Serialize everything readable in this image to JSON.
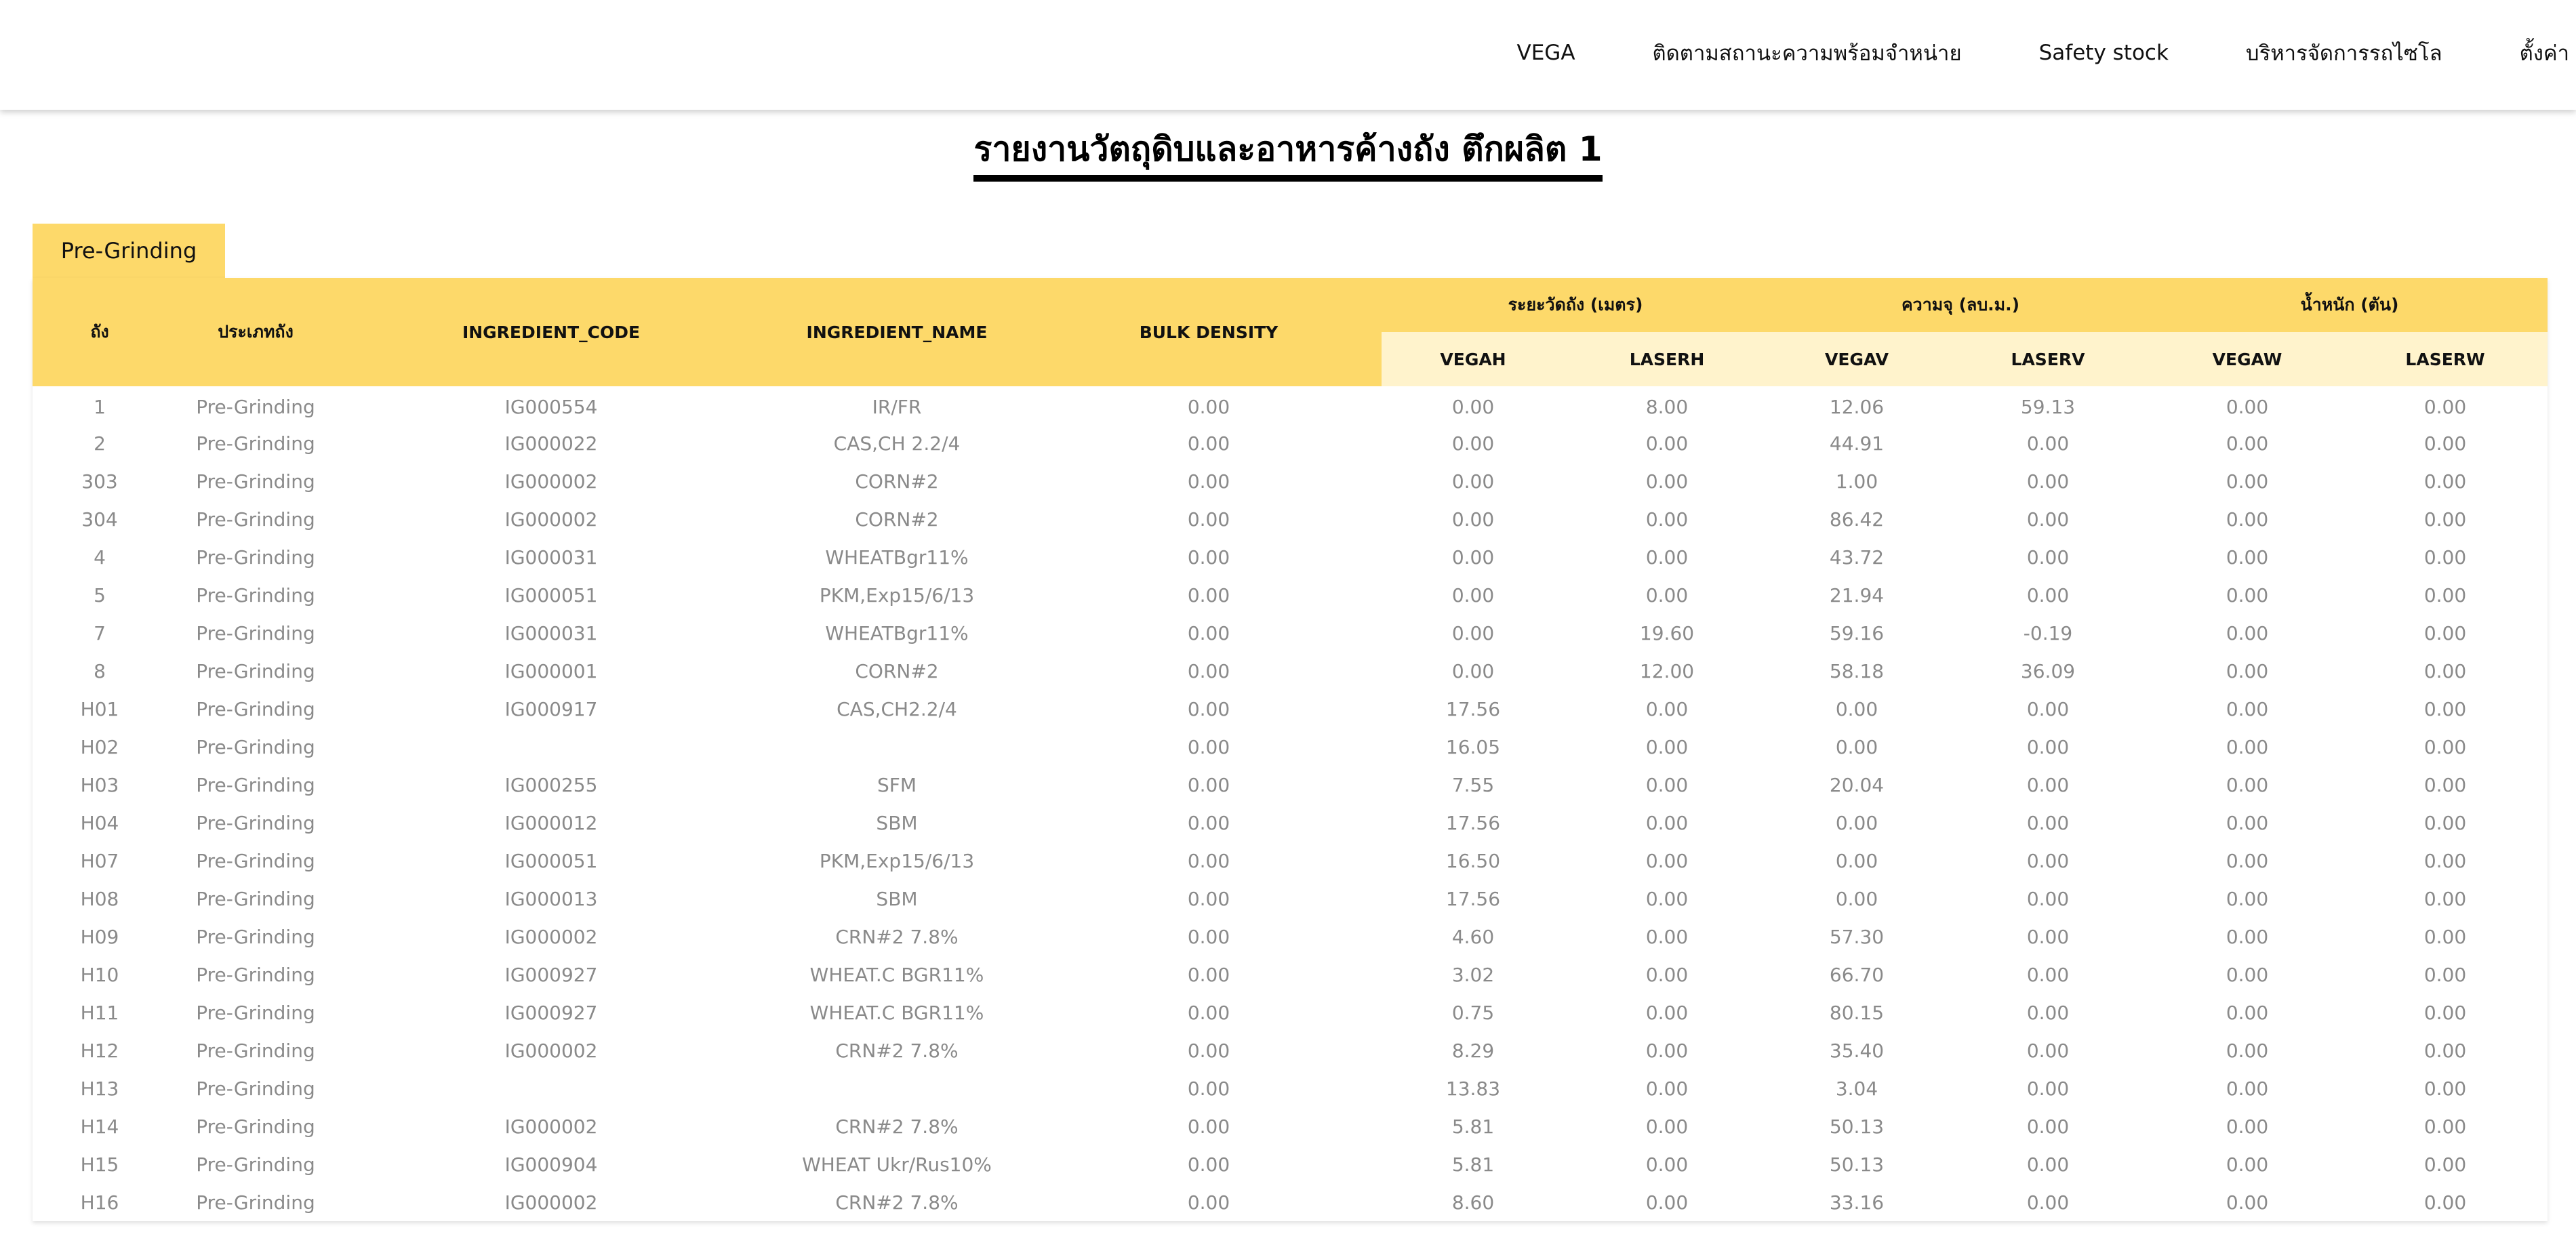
{
  "nav": {
    "items": [
      "VEGA",
      "ติดตามสถานะความพร้อมจำหน่าย",
      "Safety stock",
      "บริหารจัดการรถไซโล",
      "ตั้งค่า"
    ]
  },
  "page": {
    "title": "รายงานวัตถุดิบและอาหารค้างถัง ตึกผลิต 1"
  },
  "tab": {
    "label": "Pre-Grinding"
  },
  "colors": {
    "header_yellow": "#fdd96a",
    "subheader_yellow": "#fff3cc",
    "cell_text": "#8a8a8a"
  },
  "table": {
    "headers": {
      "tank": "ถัง",
      "tank_type": "ประเภทถัง",
      "ingredient_code": "INGREDIENT_CODE",
      "ingredient_name": "INGREDIENT_NAME",
      "bulk_density": "BULK DENSITY",
      "group_distance": "ระยะวัดถัง (เมตร)",
      "group_volume": "ความจุ (ลบ.ม.)",
      "group_weight": "น้ำหนัก (ตัน)",
      "vegah": "VEGAH",
      "laserh": "LASERH",
      "vegav": "VEGAV",
      "laserv": "LASERV",
      "vegaw": "VEGAW",
      "laserw": "LASERW"
    },
    "rows": [
      [
        "1",
        "Pre-Grinding",
        "IG000554",
        "IR/FR",
        "0.00",
        "0.00",
        "8.00",
        "12.06",
        "59.13",
        "0.00",
        "0.00"
      ],
      [
        "2",
        "Pre-Grinding",
        "IG000022",
        "CAS,CH 2.2/4",
        "0.00",
        "0.00",
        "0.00",
        "44.91",
        "0.00",
        "0.00",
        "0.00"
      ],
      [
        "303",
        "Pre-Grinding",
        "IG000002",
        "CORN#2",
        "0.00",
        "0.00",
        "0.00",
        "1.00",
        "0.00",
        "0.00",
        "0.00"
      ],
      [
        "304",
        "Pre-Grinding",
        "IG000002",
        "CORN#2",
        "0.00",
        "0.00",
        "0.00",
        "86.42",
        "0.00",
        "0.00",
        "0.00"
      ],
      [
        "4",
        "Pre-Grinding",
        "IG000031",
        "WHEATBgr11%",
        "0.00",
        "0.00",
        "0.00",
        "43.72",
        "0.00",
        "0.00",
        "0.00"
      ],
      [
        "5",
        "Pre-Grinding",
        "IG000051",
        "PKM,Exp15/6/13",
        "0.00",
        "0.00",
        "0.00",
        "21.94",
        "0.00",
        "0.00",
        "0.00"
      ],
      [
        "7",
        "Pre-Grinding",
        "IG000031",
        "WHEATBgr11%",
        "0.00",
        "0.00",
        "19.60",
        "59.16",
        "-0.19",
        "0.00",
        "0.00"
      ],
      [
        "8",
        "Pre-Grinding",
        "IG000001",
        "CORN#2",
        "0.00",
        "0.00",
        "12.00",
        "58.18",
        "36.09",
        "0.00",
        "0.00"
      ],
      [
        "H01",
        "Pre-Grinding",
        "IG000917",
        "CAS,CH2.2/4",
        "0.00",
        "17.56",
        "0.00",
        "0.00",
        "0.00",
        "0.00",
        "0.00"
      ],
      [
        "H02",
        "Pre-Grinding",
        "",
        "",
        "0.00",
        "16.05",
        "0.00",
        "0.00",
        "0.00",
        "0.00",
        "0.00"
      ],
      [
        "H03",
        "Pre-Grinding",
        "IG000255",
        "SFM",
        "0.00",
        "7.55",
        "0.00",
        "20.04",
        "0.00",
        "0.00",
        "0.00"
      ],
      [
        "H04",
        "Pre-Grinding",
        "IG000012",
        "SBM",
        "0.00",
        "17.56",
        "0.00",
        "0.00",
        "0.00",
        "0.00",
        "0.00"
      ],
      [
        "H07",
        "Pre-Grinding",
        "IG000051",
        "PKM,Exp15/6/13",
        "0.00",
        "16.50",
        "0.00",
        "0.00",
        "0.00",
        "0.00",
        "0.00"
      ],
      [
        "H08",
        "Pre-Grinding",
        "IG000013",
        "SBM",
        "0.00",
        "17.56",
        "0.00",
        "0.00",
        "0.00",
        "0.00",
        "0.00"
      ],
      [
        "H09",
        "Pre-Grinding",
        "IG000002",
        "CRN#2 7.8%",
        "0.00",
        "4.60",
        "0.00",
        "57.30",
        "0.00",
        "0.00",
        "0.00"
      ],
      [
        "H10",
        "Pre-Grinding",
        "IG000927",
        "WHEAT.C BGR11%",
        "0.00",
        "3.02",
        "0.00",
        "66.70",
        "0.00",
        "0.00",
        "0.00"
      ],
      [
        "H11",
        "Pre-Grinding",
        "IG000927",
        "WHEAT.C BGR11%",
        "0.00",
        "0.75",
        "0.00",
        "80.15",
        "0.00",
        "0.00",
        "0.00"
      ],
      [
        "H12",
        "Pre-Grinding",
        "IG000002",
        "CRN#2 7.8%",
        "0.00",
        "8.29",
        "0.00",
        "35.40",
        "0.00",
        "0.00",
        "0.00"
      ],
      [
        "H13",
        "Pre-Grinding",
        "",
        "",
        "0.00",
        "13.83",
        "0.00",
        "3.04",
        "0.00",
        "0.00",
        "0.00"
      ],
      [
        "H14",
        "Pre-Grinding",
        "IG000002",
        "CRN#2 7.8%",
        "0.00",
        "5.81",
        "0.00",
        "50.13",
        "0.00",
        "0.00",
        "0.00"
      ],
      [
        "H15",
        "Pre-Grinding",
        "IG000904",
        "WHEAT Ukr/Rus10%",
        "0.00",
        "5.81",
        "0.00",
        "50.13",
        "0.00",
        "0.00",
        "0.00"
      ],
      [
        "H16",
        "Pre-Grinding",
        "IG000002",
        "CRN#2 7.8%",
        "0.00",
        "8.60",
        "0.00",
        "33.16",
        "0.00",
        "0.00",
        "0.00"
      ]
    ]
  }
}
